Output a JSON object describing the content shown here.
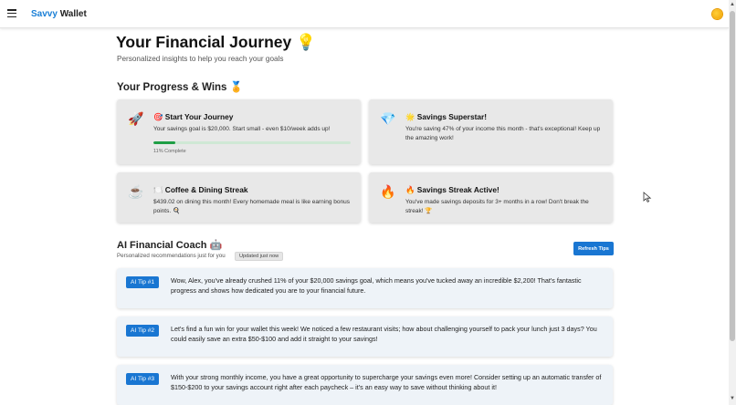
{
  "header": {
    "brand_part1": "Savvy",
    "brand_part2": "Wallet",
    "accent_color": "#1a7fd6",
    "menu_icon": "hamburger-menu-icon",
    "avatar_icon": "sun-avatar-icon"
  },
  "page": {
    "title": "Your Financial Journey",
    "title_icon": "💡",
    "subtitle": "Personalized insights to help you reach your goals"
  },
  "progress_section": {
    "title": "Your Progress & Wins",
    "title_icon": "🏅",
    "cards": [
      {
        "icon": "🚀",
        "title_emoji": "🎯",
        "title": "Start Your Journey",
        "body": "Your savings goal is $20,000. Start small - even $10/week adds up!",
        "progress_percent": 11,
        "progress_label": "11% Complete"
      },
      {
        "icon": "💎",
        "title_emoji": "🌟",
        "title": "Savings Superstar!",
        "body": "You're saving 47% of your income this month - that's exceptional! Keep up the amazing work!"
      },
      {
        "icon": "☕",
        "title_emoji": "🍽️",
        "title": "Coffee & Dining Streak",
        "body": "$439.02 on dining this month! Every homemade meal is like earning bonus points. 🍳"
      },
      {
        "icon": "🔥",
        "title_emoji": "🔥",
        "title": "Savings Streak Active!",
        "body": "You've made savings deposits for 3+ months in a row! Don't break the streak! 🏆"
      }
    ]
  },
  "coach": {
    "title": "AI Financial Coach",
    "title_icon": "🤖",
    "subtitle": "Personalized recommendations just for you",
    "updated_badge": "Updated just now",
    "refresh_label": "Refresh Tips",
    "tips": [
      {
        "badge": "AI Tip #1",
        "text": "Wow, Alex, you've already crushed 11% of your $20,000 savings goal, which means you've tucked away an incredible $2,200! That's fantastic progress and shows how dedicated you are to your financial future."
      },
      {
        "badge": "AI Tip #2",
        "text": "Let's find a fun win for your wallet this week! We noticed a few restaurant visits; how about challenging yourself to pack your lunch just 3 days? You could easily save an extra $50-$100 and add it straight to your savings!"
      },
      {
        "badge": "AI Tip #3",
        "text": "With your strong monthly income, you have a great opportunity to supercharge your savings even more! Consider setting up an automatic transfer of $150-$200 to your savings account right after each paycheck – it's an easy way to save without thinking about it!"
      }
    ]
  }
}
